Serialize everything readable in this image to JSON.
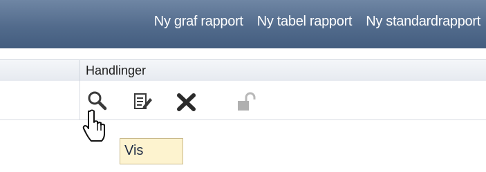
{
  "toolbar": {
    "links": [
      {
        "label": "Ny graf rapport"
      },
      {
        "label": "Ny tabel rapport"
      },
      {
        "label": "Ny standardrapport"
      }
    ]
  },
  "table": {
    "header": {
      "actions_label": "Handlinger"
    },
    "row_actions": [
      {
        "icon": "search-icon",
        "action": "view"
      },
      {
        "icon": "edit-icon",
        "action": "edit"
      },
      {
        "icon": "delete-x-icon",
        "action": "delete"
      },
      {
        "icon": "unlock-icon",
        "action": "unlock"
      }
    ]
  },
  "tooltip": {
    "text": "Vis"
  },
  "colors": {
    "toolbar_bg": "#526b8c",
    "tooltip_bg": "#fdf3cf",
    "delete_icon": "#2b2b2b"
  }
}
